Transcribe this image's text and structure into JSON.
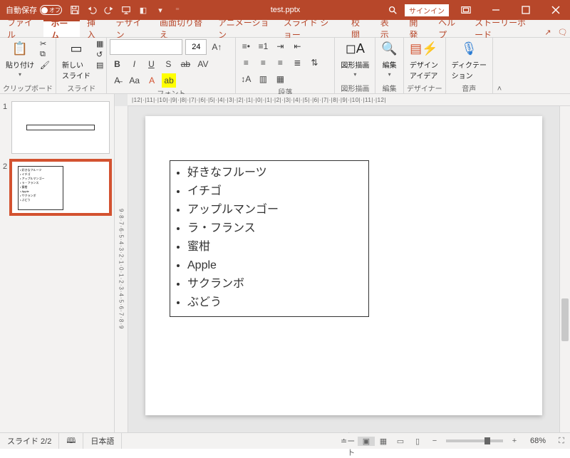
{
  "titlebar": {
    "autosave_label": "自動保存",
    "autosave_state": "オフ",
    "filename": "test.pptx",
    "signin": "サインイン"
  },
  "tabs": [
    "ファイル",
    "ホーム",
    "挿入",
    "デザイン",
    "画面切り替え",
    "アニメーション",
    "スライド ショー",
    "校閲",
    "表示",
    "開発",
    "ヘルプ",
    "ストーリーボード"
  ],
  "active_tab": 1,
  "ribbon": {
    "clipboard": {
      "label": "クリップボード",
      "paste": "貼り付け"
    },
    "slides": {
      "label": "スライド",
      "new": "新しい\nスライド"
    },
    "font": {
      "label": "フォント",
      "size": "24"
    },
    "paragraph": {
      "label": "段落"
    },
    "drawing": {
      "label": "図形描画",
      "btn": "図形描画"
    },
    "editing": {
      "label": "編集",
      "btn": "編集"
    },
    "designer": {
      "label": "デザイナー",
      "btn": "デザイン\nアイデア"
    },
    "voice": {
      "label": "音声",
      "btn": "ディクテー\nション"
    }
  },
  "ruler_h": "|12|·|11|·|10|·|9|·|8|·|7|·|6|·|5|·|4|·|3|·|2|·|1|·|0|·|1|·|2|·|3|·|4|·|5|·|6|·|7|·|8|·|9|·|10|·|11|·|12|",
  "ruler_v": "9·8·7·6·5·4·3·2·1·0·1·2·3·4·5·6·7·8·9",
  "slide": {
    "items": [
      "好きなフルーツ",
      "イチゴ",
      "アップルマンゴー",
      "ラ・フランス",
      "蜜柑",
      "Apple",
      "サクランボ",
      "ぶどう"
    ]
  },
  "status": {
    "slide": "スライド 2/2",
    "lang": "日本語",
    "notes": "ノート",
    "zoom": "68%"
  }
}
